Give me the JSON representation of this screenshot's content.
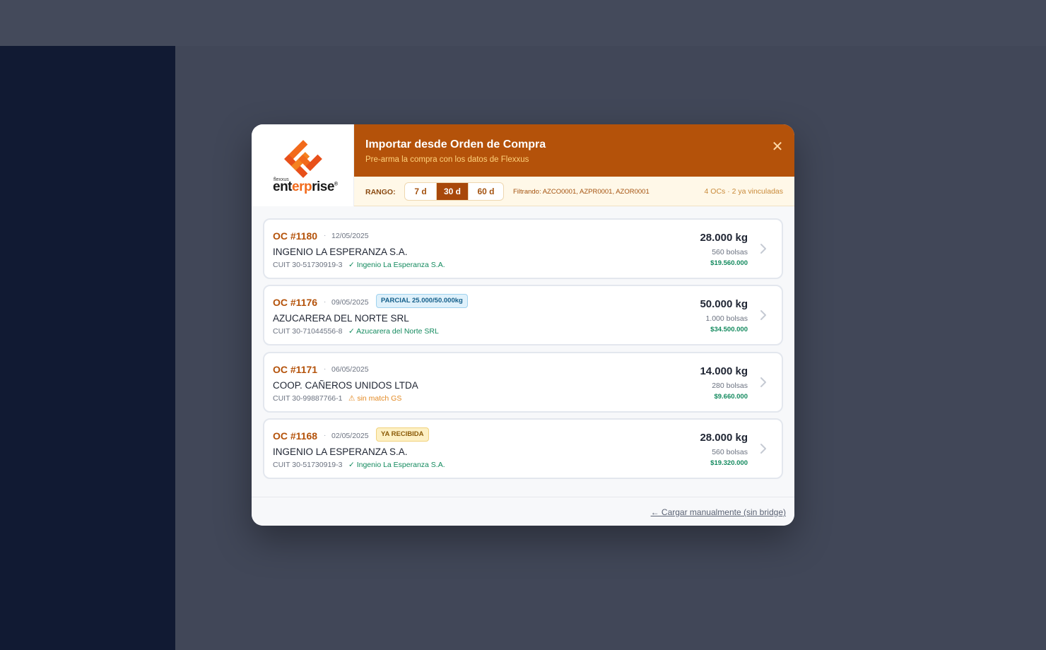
{
  "modal": {
    "logo": {
      "brand_small": "flexxus",
      "word_a": "ent",
      "word_b": "erp",
      "word_c": "rise",
      "mark": "®"
    },
    "title": "Importar desde Orden de Compra",
    "subtitle": "Pre-arma la compra con los datos de Flexxus",
    "close_icon": "close-icon",
    "filters": {
      "range_label": "RANGO:",
      "ranges": [
        "7 d",
        "30 d",
        "60 d"
      ],
      "selected_range": "30 d",
      "filtering": "Filtrando: AZCO0001, AZPR0001, AZOR0001",
      "counts": "4 OCs · 2 ya vinculadas"
    },
    "orders": [
      {
        "oc": "OC #1180",
        "sep": "·",
        "date": "12/05/2025",
        "badge": "",
        "supplier": "INGENIO LA ESPERANZA S.A.",
        "cuit": "CUIT 30-51730919-3",
        "match": "✓ Ingenio La Esperanza S.A.",
        "match_ok": true,
        "weight": "28.000 kg",
        "bags": "560 bolsas",
        "amount": "$19.560.000"
      },
      {
        "oc": "OC #1176",
        "sep": "·",
        "date": "09/05/2025",
        "badge": "PARCIAL 25.000/50.000kg",
        "badge_type": "partial",
        "supplier": "AZUCARERA DEL NORTE SRL",
        "cuit": "CUIT 30-71044556-8",
        "match": "✓ Azucarera del Norte SRL",
        "match_ok": true,
        "weight": "50.000 kg",
        "bags": "1.000 bolsas",
        "amount": "$34.500.000"
      },
      {
        "oc": "OC #1171",
        "sep": "·",
        "date": "06/05/2025",
        "badge": "",
        "supplier": "COOP. CAÑEROS UNIDOS LTDA",
        "cuit": "CUIT 30-99887766-1",
        "match": "⚠ sin match GS",
        "match_ok": false,
        "weight": "14.000 kg",
        "bags": "280 bolsas",
        "amount": "$9.660.000"
      },
      {
        "oc": "OC #1168",
        "sep": "·",
        "date": "02/05/2025",
        "badge": "YA RECIBIDA",
        "badge_type": "received",
        "supplier": "INGENIO LA ESPERANZA S.A.",
        "cuit": "CUIT 30-51730919-3",
        "match": "✓ Ingenio La Esperanza S.A.",
        "match_ok": true,
        "weight": "28.000 kg",
        "bags": "560 bolsas",
        "amount": "$19.320.000"
      }
    ],
    "footer": {
      "manual_link": "← Cargar manualmente (sin bridge)"
    }
  },
  "colors": {
    "accent": "#b4520a",
    "ok": "#138a5e",
    "warn": "#e38a24"
  }
}
